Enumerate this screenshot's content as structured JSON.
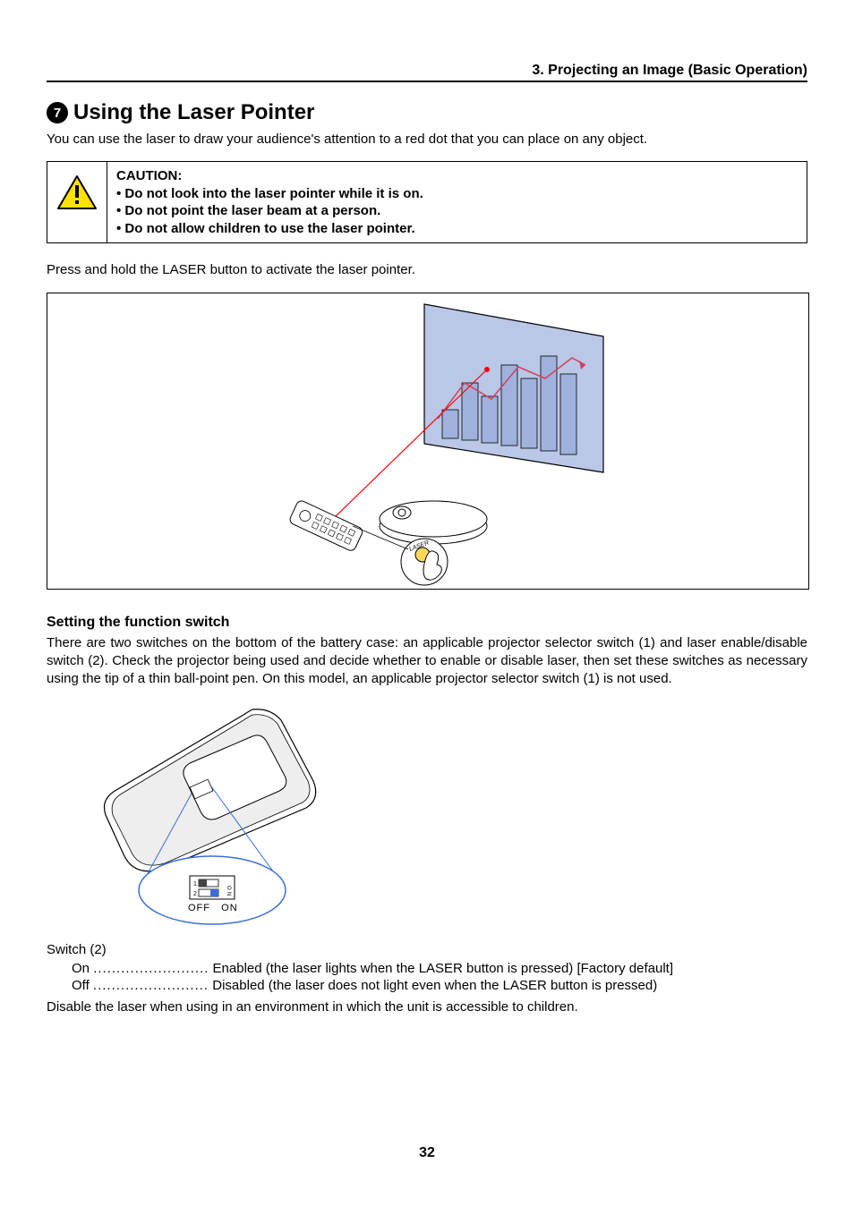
{
  "chapter_title": "3. Projecting an Image (Basic Operation)",
  "section": {
    "number": "7",
    "title": "Using the Laser Pointer"
  },
  "intro_text": "You can use the laser to draw your audience's attention to a red dot that you can place on any object.",
  "caution": {
    "title": "CAUTION:",
    "bullets": [
      "Do not look into the laser pointer while it is on.",
      "Do not point the laser beam at a person.",
      "Do not allow children to use the laser pointer."
    ]
  },
  "press_hold_text": "Press and hold the LASER button to activate the laser pointer.",
  "laser_label": "LASER",
  "sub_heading": "Setting the function switch",
  "function_switch_text": "There are two switches on the bottom of the battery case: an applicable projector selector switch (1) and laser enable/disable switch (2). Check the projector being used and decide whether to enable or disable laser, then set these switches as necessary using the tip of a thin ball-point pen. On this model, an applicable projector selector switch (1) is not used.",
  "off_label": "OFF",
  "on_label": "ON",
  "switch_num_1": "1",
  "switch_num_2": "2",
  "switch_on_side": "ON",
  "switch_label": "Switch (2)",
  "definitions": {
    "on_label": "On",
    "on_dots": ".........................",
    "on_desc": "Enabled (the laser lights when the LASER button is pressed) [Factory default]",
    "off_label": "Off",
    "off_dots": ".........................",
    "off_desc": "Disabled (the laser does not light even when the LASER button is pressed)"
  },
  "disable_note": "Disable the laser when using in an environment in which the unit is accessible to children.",
  "page_number": "32"
}
